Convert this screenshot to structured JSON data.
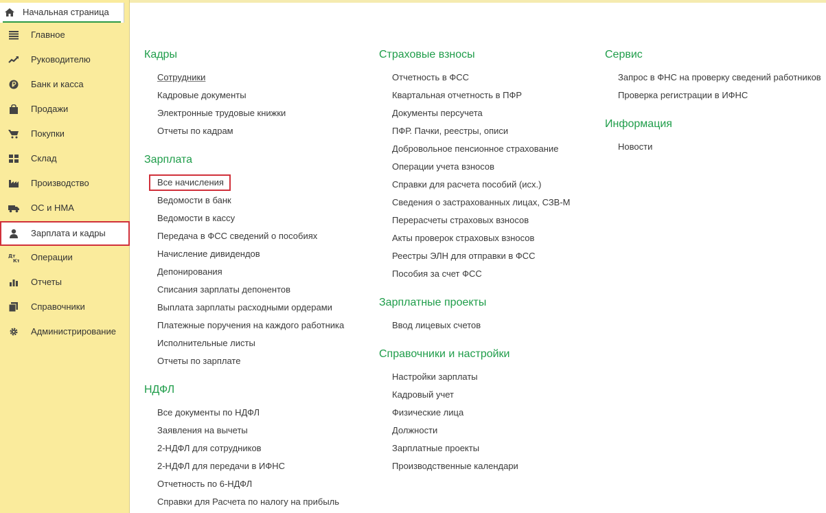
{
  "home_tab": {
    "label": "Начальная страница"
  },
  "sidebar": {
    "items": [
      {
        "label": "Главное",
        "icon": "menu-lines-icon"
      },
      {
        "label": "Руководителю",
        "icon": "trend-chart-icon"
      },
      {
        "label": "Банк и касса",
        "icon": "ruble-coin-icon"
      },
      {
        "label": "Продажи",
        "icon": "shopping-bag-icon"
      },
      {
        "label": "Покупки",
        "icon": "shopping-cart-icon"
      },
      {
        "label": "Склад",
        "icon": "warehouse-grid-icon"
      },
      {
        "label": "Производство",
        "icon": "factory-icon"
      },
      {
        "label": "ОС и НМА",
        "icon": "truck-icon"
      },
      {
        "label": "Зарплата и кадры",
        "icon": "person-icon",
        "active": true
      },
      {
        "label": "Операции",
        "icon": "debit-credit-icon"
      },
      {
        "label": "Отчеты",
        "icon": "bar-chart-icon"
      },
      {
        "label": "Справочники",
        "icon": "books-icon"
      },
      {
        "label": "Администрирование",
        "icon": "gear-icon"
      }
    ]
  },
  "content": {
    "kadry": {
      "title": "Кадры",
      "links": [
        "Сотрудники",
        "Кадровые документы",
        "Электронные трудовые книжки",
        "Отчеты по кадрам"
      ]
    },
    "zarplata": {
      "title": "Зарплата",
      "links": [
        "Все начисления",
        "Ведомости в банк",
        "Ведомости в кассу",
        "Передача в ФСС сведений о пособиях",
        "Начисление дивидендов",
        "Депонирования",
        "Списания зарплаты депонентов",
        "Выплата зарплаты расходными ордерами",
        "Платежные поручения на каждого работника",
        "Исполнительные листы",
        "Отчеты по зарплате"
      ]
    },
    "ndfl": {
      "title": "НДФЛ",
      "links": [
        "Все документы по НДФЛ",
        "Заявления на вычеты",
        "2-НДФЛ для сотрудников",
        "2-НДФЛ для передачи в ИФНС",
        "Отчетность по 6-НДФЛ",
        "Справки для Расчета по налогу на прибыль"
      ]
    },
    "strakhovye": {
      "title": "Страховые взносы",
      "links": [
        "Отчетность в ФСС",
        "Квартальная отчетность в ПФР",
        "Документы персучета",
        "ПФР. Пачки, реестры, описи",
        "Добровольное пенсионное страхование",
        "Операции учета взносов",
        "Справки для расчета пособий (исх.)",
        "Сведения о застрахованных лицах, СЗВ-М",
        "Перерасчеты страховых взносов",
        "Акты проверок страховых взносов",
        "Реестры ЭЛН для отправки в ФСС",
        "Пособия за счет ФСС"
      ]
    },
    "zp_proekty": {
      "title": "Зарплатные проекты",
      "links": [
        "Ввод лицевых счетов"
      ]
    },
    "spravochniki": {
      "title": "Справочники и настройки",
      "links": [
        "Настройки зарплаты",
        "Кадровый учет",
        "Физические лица",
        "Должности",
        "Зарплатные проекты",
        "Производственные календари"
      ]
    },
    "servis": {
      "title": "Сервис",
      "links": [
        "Запрос в ФНС на проверку сведений работников",
        "Проверка регистрации в ИФНС"
      ]
    },
    "informatsiya": {
      "title": "Информация",
      "links": [
        "Новости"
      ]
    }
  },
  "colors": {
    "sidebar_bg": "#faeb9c",
    "section_title": "#1f9d4a",
    "highlight_border": "#d0303a"
  }
}
